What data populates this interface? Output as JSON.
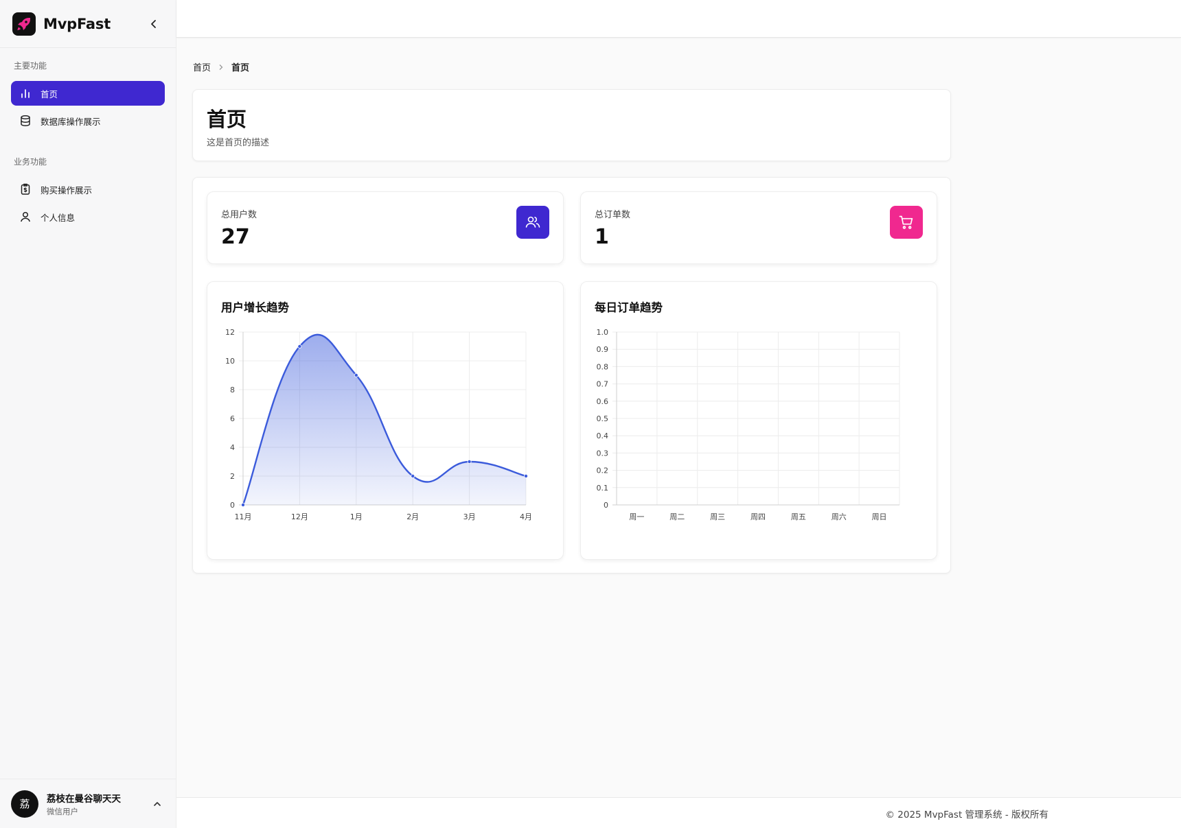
{
  "app": {
    "name": "MvpFast"
  },
  "sidebar": {
    "groups": [
      {
        "label": "主要功能",
        "items": [
          {
            "label": "首页",
            "icon": "bar-chart-icon",
            "active": true
          },
          {
            "label": "数据库操作展示",
            "icon": "database-icon",
            "active": false
          }
        ]
      },
      {
        "label": "业务功能",
        "items": [
          {
            "label": "购买操作展示",
            "icon": "receipt-icon",
            "active": false
          },
          {
            "label": "个人信息",
            "icon": "user-icon",
            "active": false
          }
        ]
      }
    ],
    "user": {
      "avatar_text": "荔",
      "name": "荔枝在曼谷聊天天",
      "subtitle": "微信用户"
    }
  },
  "breadcrumb": [
    "首页",
    "首页"
  ],
  "page": {
    "title": "首页",
    "description": "这是首页的描述"
  },
  "stats": [
    {
      "label": "总用户数",
      "value": "27",
      "icon": "users-icon",
      "color": "#3f28d0"
    },
    {
      "label": "总订单数",
      "value": "1",
      "icon": "cart-icon",
      "color": "#f0288f"
    }
  ],
  "charts": {
    "user_growth": {
      "title": "用户增长趋势"
    },
    "daily_orders": {
      "title": "每日订单趋势"
    }
  },
  "chart_data": [
    {
      "type": "area",
      "title": "用户增长趋势",
      "x": [
        "11月",
        "12月",
        "1月",
        "2月",
        "3月",
        "4月"
      ],
      "values": [
        0,
        11,
        9,
        2,
        3,
        2
      ],
      "ylim": [
        0,
        12
      ],
      "yticks": [
        "0",
        "2",
        "4",
        "6",
        "8",
        "10",
        "12"
      ],
      "color": "#3b5bdb",
      "grid": true
    },
    {
      "type": "line",
      "title": "每日订单趋势",
      "x": [
        "周一",
        "周二",
        "周三",
        "周四",
        "周五",
        "周六",
        "周日"
      ],
      "values": [],
      "ylim": [
        0,
        1.0
      ],
      "yticks": [
        "0",
        "0.1",
        "0.2",
        "0.3",
        "0.4",
        "0.5",
        "0.6",
        "0.7",
        "0.8",
        "0.9",
        "1.0"
      ],
      "grid": true
    }
  ],
  "footer": {
    "text": "© 2025 MvpFast 管理系统 - 版权所有"
  }
}
